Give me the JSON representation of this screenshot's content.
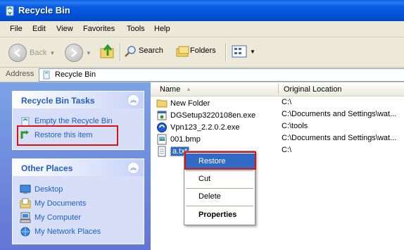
{
  "window": {
    "title": "Recycle Bin"
  },
  "menu": [
    "File",
    "Edit",
    "View",
    "Favorites",
    "Tools",
    "Help"
  ],
  "toolbar": {
    "back": "Back",
    "search": "Search",
    "folders": "Folders"
  },
  "address": {
    "label": "Address",
    "value": "Recycle Bin"
  },
  "tasks": {
    "title": "Recycle Bin Tasks",
    "items": [
      "Empty the Recycle Bin",
      "Restore this item"
    ]
  },
  "places": {
    "title": "Other Places",
    "items": [
      "Desktop",
      "My Documents",
      "My Computer",
      "My Network Places"
    ]
  },
  "columns": {
    "name": "Name",
    "location": "Original Location"
  },
  "files": [
    {
      "name": "New Folder",
      "location": "C:\\",
      "icon": "folder-icon"
    },
    {
      "name": "DGSetup3220108en.exe",
      "location": "C:\\Documents and Settings\\wat...",
      "icon": "exe-icon"
    },
    {
      "name": "Vpn123_2.2.0.2.exe",
      "location": "C:\\tools",
      "icon": "exe-icon"
    },
    {
      "name": "001.bmp",
      "location": "C:\\Documents and Settings\\wat...",
      "icon": "bmp-icon"
    },
    {
      "name": "a.txt",
      "location": "C:\\",
      "icon": "txt-icon",
      "selected": true
    }
  ],
  "context_menu": [
    "Restore",
    "Cut",
    "Delete",
    "Properties"
  ]
}
